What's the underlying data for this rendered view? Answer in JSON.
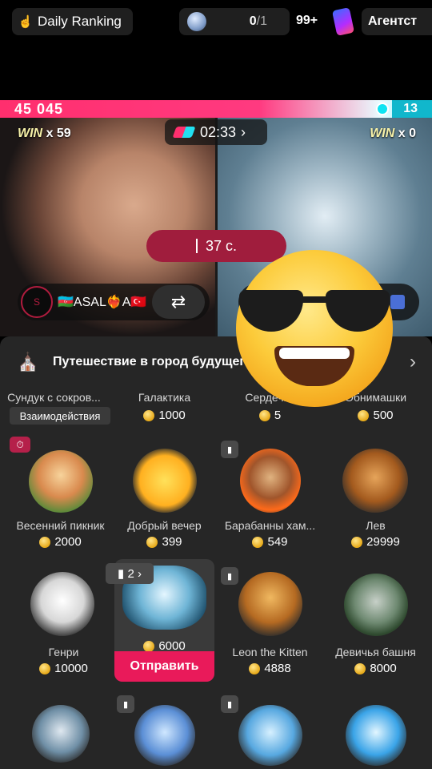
{
  "topbar": {
    "ranking_label": "Daily Ranking",
    "task_count": "0",
    "task_total": "/1",
    "badge": "99+",
    "agent_label": "Агентст"
  },
  "battle": {
    "score_left": "45 045",
    "score_right": "13",
    "win_left_label": "WIN",
    "win_left_count": "x 59",
    "win_right_label": "WIN",
    "win_right_count": "x 0",
    "timer": "02:33",
    "countdown": "37 с.",
    "host_name": "🇦🇿ASAL❤️‍🔥A🇹🇷"
  },
  "panel": {
    "journey_title": "Путешествие в город будущего",
    "gifts": [
      {
        "name": "Сундук с сокров...",
        "tag": "Взаимодействия"
      },
      {
        "name": "Галактика",
        "price": "1000"
      },
      {
        "name": "Сердечко",
        "price": "5"
      },
      {
        "name": "Обнимашки",
        "price": "500"
      },
      {
        "name": "Весенний пикник",
        "price": "2000"
      },
      {
        "name": "Добрый вечер",
        "price": "399"
      },
      {
        "name": "Барабанны хам...",
        "price": "549"
      },
      {
        "name": "Лев",
        "price": "29999"
      },
      {
        "name": "Генри",
        "price": "10000"
      },
      {
        "price": "6000"
      },
      {
        "name": "Leon the Kitten",
        "price": "4888"
      },
      {
        "name": "Девичья башня",
        "price": "8000"
      }
    ],
    "multiplier": "2",
    "send_label": "Отправить"
  }
}
